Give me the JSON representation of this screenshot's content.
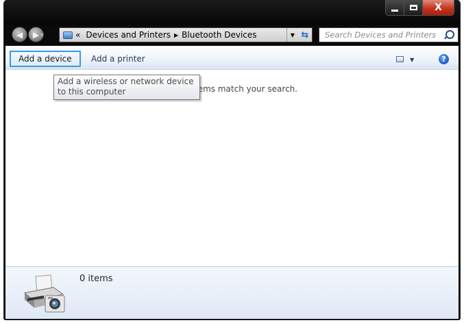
{
  "window": {
    "close_glyph": "X"
  },
  "address": {
    "overflow_chevron": "«",
    "crumbs": [
      "Devices and Printers",
      "Bluetooth Devices"
    ],
    "separator": "▶"
  },
  "search": {
    "placeholder": "Search Devices and Printers"
  },
  "toolbar": {
    "add_device": "Add a device",
    "add_printer": "Add a printer",
    "help_glyph": "?"
  },
  "content": {
    "empty_message": "tems match your search."
  },
  "tooltip": {
    "text": "Add a wireless or network device to this computer"
  },
  "details": {
    "item_count": "0 items"
  },
  "colors": {
    "toolbar_accent": "#3b9ad9",
    "close_red": "#c4351f",
    "link_text": "#1e395b"
  }
}
